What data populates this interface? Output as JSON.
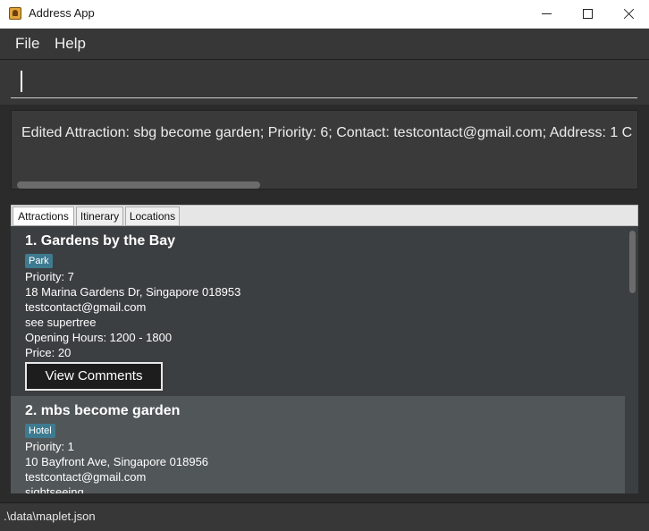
{
  "window": {
    "title": "Address App",
    "controls": {
      "minimize_icon": "minimize-icon",
      "maximize_icon": "maximize-icon",
      "close_icon": "close-icon"
    }
  },
  "menu": {
    "file": "File",
    "help": "Help"
  },
  "command": {
    "value": "",
    "placeholder": ""
  },
  "result": {
    "text": "Edited Attraction: sbg become garden; Priority: 6; Contact: testcontact@gmail.com; Address: 1 C"
  },
  "tabs": [
    {
      "label": "Attractions",
      "active": true
    },
    {
      "label": "Itinerary",
      "active": false
    },
    {
      "label": "Locations",
      "active": false
    }
  ],
  "attractions": [
    {
      "index": "1.",
      "name": "Gardens by the Bay",
      "tag": "Park",
      "priority": "Priority: 7",
      "address": "18 Marina Gardens Dr, Singapore 018953",
      "contact": "testcontact@gmail.com",
      "activity": "see supertree",
      "hours": "Opening Hours: 1200 - 1800",
      "price": "Price: 20",
      "button": "View Comments"
    },
    {
      "index": "2.",
      "name": "mbs become garden",
      "tag": "Hotel",
      "priority": "Priority: 1",
      "address": "10 Bayfront Ave, Singapore 018956",
      "contact": "testcontact@gmail.com",
      "activity": "sightseeing"
    }
  ],
  "status": {
    "path": ".\\data\\maplet.json"
  },
  "colors": {
    "tag_bg": "#3e7b91",
    "selected_card": "#515658",
    "panel_bg": "#3c3f41"
  }
}
